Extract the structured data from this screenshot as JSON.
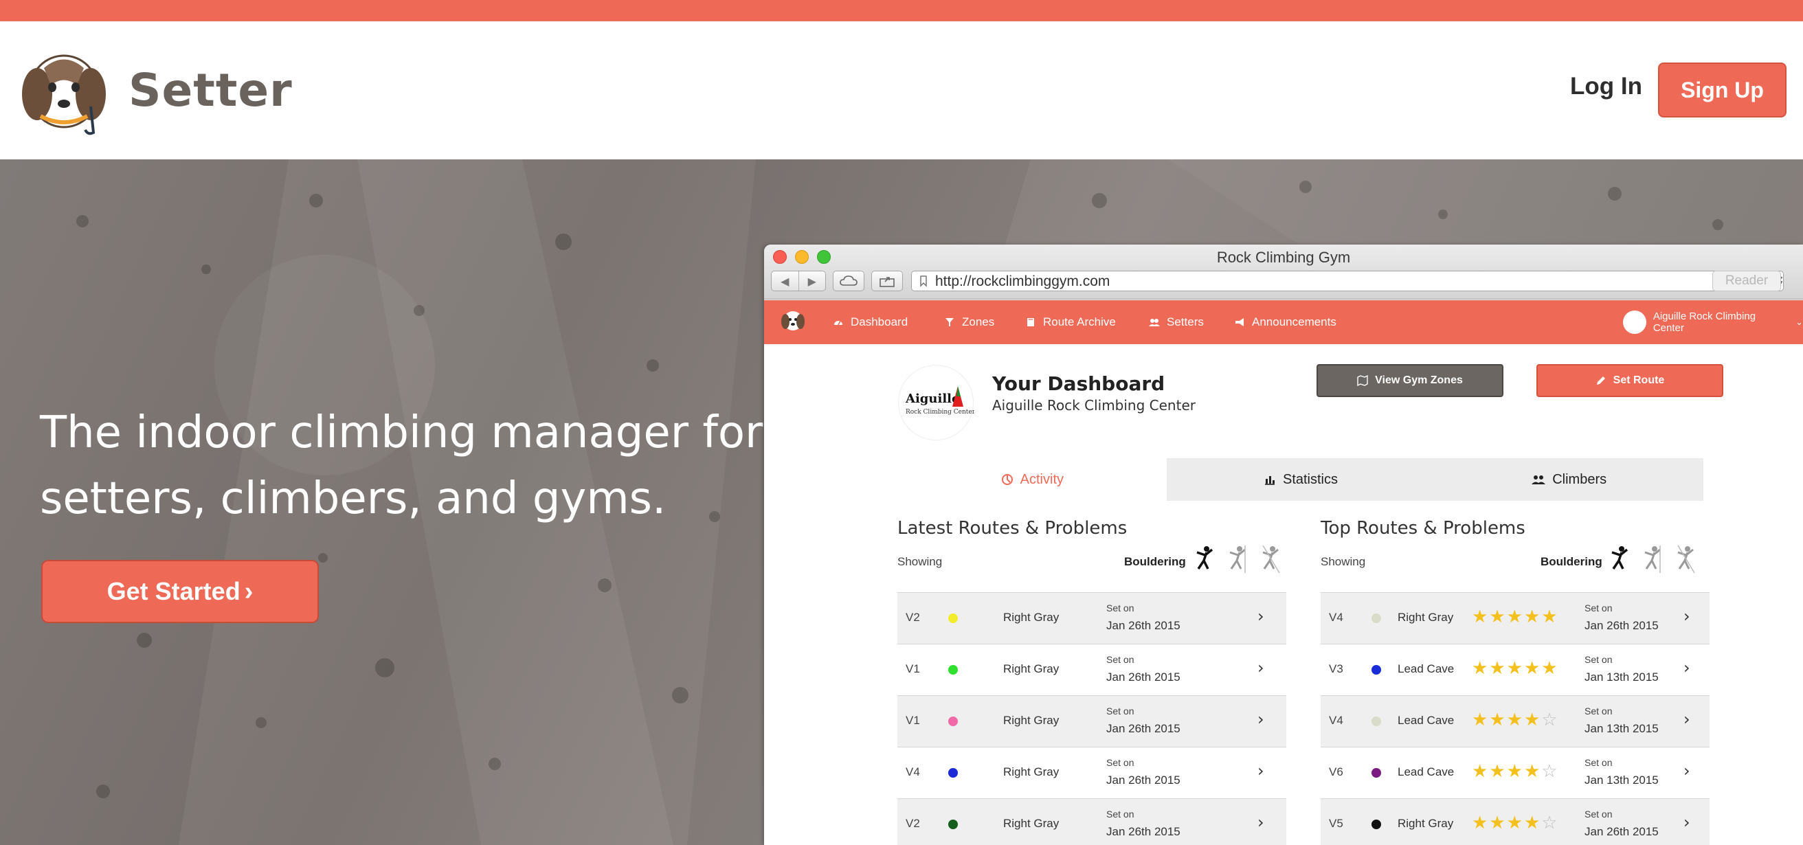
{
  "header": {
    "brand": "Setter",
    "login_label": "Log In",
    "signup_label": "Sign Up"
  },
  "hero": {
    "title_line1": "The indoor climbing manager for",
    "title_line2": "setters, climbers, and gyms.",
    "cta_label": "Get Started"
  },
  "browser": {
    "window_title": "Rock Climbing Gym",
    "url": "http://rockclimbinggym.com",
    "reader_label": "Reader"
  },
  "app": {
    "nav": [
      {
        "label": "Dashboard",
        "icon": "dashboard-icon"
      },
      {
        "label": "Zones",
        "icon": "zones-icon"
      },
      {
        "label": "Route Archive",
        "icon": "book-icon"
      },
      {
        "label": "Setters",
        "icon": "users-icon"
      },
      {
        "label": "Announcements",
        "icon": "megaphone-icon"
      }
    ],
    "gym_name": "Aiguille Rock Climbing Center",
    "logo_text": "Aiguille",
    "logo_subtext": "Rock Climbing Center",
    "dashboard_title": "Your Dashboard",
    "dashboard_subtitle": "Aiguille Rock Climbing Center",
    "view_zones_label": "View Gym Zones",
    "set_route_label": "Set Route",
    "tabs": [
      {
        "label": "Activity",
        "active": true
      },
      {
        "label": "Statistics",
        "active": false
      },
      {
        "label": "Climbers",
        "active": false
      }
    ],
    "latest": {
      "title": "Latest Routes & Problems",
      "showing": "Showing",
      "filter": "Bouldering",
      "set_on": "Set on",
      "rows": [
        {
          "grade": "V2",
          "color": "#f2ec2c",
          "zone": "Right Gray",
          "date": "Jan 26th 2015"
        },
        {
          "grade": "V1",
          "color": "#2fe02f",
          "zone": "Right Gray",
          "date": "Jan 26th 2015"
        },
        {
          "grade": "V1",
          "color": "#f06aa8",
          "zone": "Right Gray",
          "date": "Jan 26th 2015"
        },
        {
          "grade": "V4",
          "color": "#1b2ad6",
          "zone": "Right Gray",
          "date": "Jan 26th 2015"
        },
        {
          "grade": "V2",
          "color": "#165e1c",
          "zone": "Right Gray",
          "date": "Jan 26th 2015"
        }
      ]
    },
    "top": {
      "title": "Top Routes & Problems",
      "showing": "Showing",
      "filter": "Bouldering",
      "set_on": "Set on",
      "rows": [
        {
          "grade": "V4",
          "color": "#d9dcc8",
          "zone": "Right Gray",
          "stars": 5,
          "date": "Jan 26th 2015"
        },
        {
          "grade": "V3",
          "color": "#1a2bd8",
          "zone": "Lead Cave",
          "stars": 5,
          "date": "Jan 13th 2015"
        },
        {
          "grade": "V4",
          "color": "#d9dcc8",
          "zone": "Lead Cave",
          "stars": 4,
          "date": "Jan 13th 2015"
        },
        {
          "grade": "V6",
          "color": "#7a1a82",
          "zone": "Lead Cave",
          "stars": 4,
          "date": "Jan 13th 2015"
        },
        {
          "grade": "V5",
          "color": "#111111",
          "zone": "Right Gray",
          "stars": 4,
          "date": "Jan 26th 2015"
        }
      ]
    }
  },
  "colors": {
    "accent": "#ee6a56",
    "dark_button": "#6b6661",
    "star": "#f4c01e"
  }
}
